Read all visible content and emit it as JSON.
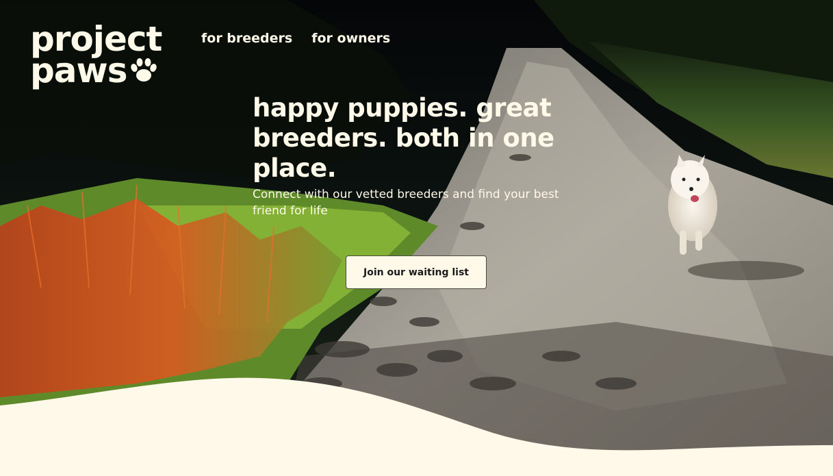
{
  "brand": {
    "logo_line1": "project",
    "logo_line2": "paws",
    "logo_icon": "paw-print-icon"
  },
  "nav": {
    "items": [
      {
        "label": "for breeders"
      },
      {
        "label": "for owners"
      }
    ]
  },
  "hero": {
    "headline": "happy puppies. great breeders.  both in one place.",
    "subtitle": "Connect with our vetted breeders and find your best friend for life",
    "cta_label": "Join our waiting list",
    "background_description_icon": "dog-on-path-photo"
  },
  "colors": {
    "cream": "#FFF9E9",
    "text_dark": "#1b1b1b"
  }
}
